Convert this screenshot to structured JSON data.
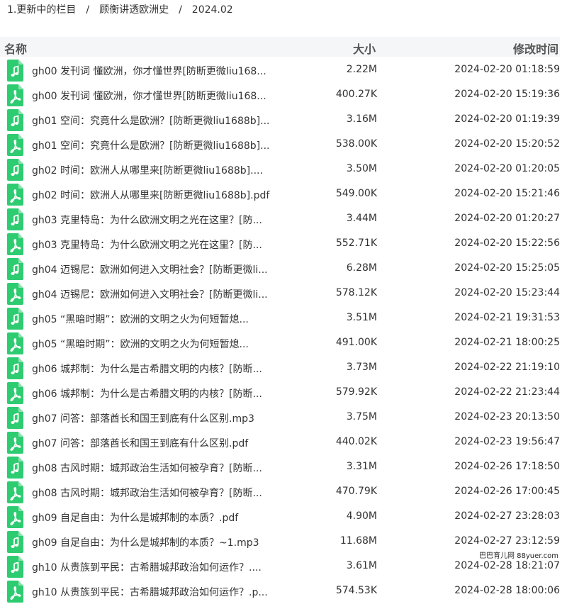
{
  "breadcrumb": {
    "items": [
      "1.更新中的栏目",
      "顾衡讲透欧洲史",
      "2024.02"
    ],
    "separator": "/"
  },
  "table": {
    "headers": {
      "name": "名称",
      "size": "大小",
      "time": "修改时间"
    },
    "rows": [
      {
        "name": "gh00 发刊词 懂欧洲，你才懂世界[防断更微liu168...",
        "size": "2.22M",
        "time": "2024-02-20 01:18:59",
        "icon": "mp3-file-icon"
      },
      {
        "name": "gh00 发刊词 懂欧洲，你才懂世界[防断更微liu168...",
        "size": "400.27K",
        "time": "2024-02-20 15:19:36",
        "icon": "pdf-file-icon"
      },
      {
        "name": "gh01 空间：究竟什么是欧洲？[防断更微liu1688b]...",
        "size": "3.16M",
        "time": "2024-02-20 01:19:39",
        "icon": "mp3-file-icon"
      },
      {
        "name": "gh01 空间：究竟什么是欧洲？[防断更微liu1688b]...",
        "size": "538.00K",
        "time": "2024-02-20 15:20:52",
        "icon": "pdf-file-icon"
      },
      {
        "name": "gh02 时间：欧洲人从哪里来[防断更微liu1688b]....",
        "size": "3.50M",
        "time": "2024-02-20 01:20:05",
        "icon": "mp3-file-icon"
      },
      {
        "name": "gh02 时间：欧洲人从哪里来[防断更微liu1688b].pdf",
        "size": "549.00K",
        "time": "2024-02-20 15:21:46",
        "icon": "pdf-file-icon"
      },
      {
        "name": "gh03 克里特岛：为什么欧洲文明之光在这里？[防...",
        "size": "3.44M",
        "time": "2024-02-20 01:20:27",
        "icon": "mp3-file-icon"
      },
      {
        "name": "gh03 克里特岛：为什么欧洲文明之光在这里？[防...",
        "size": "552.71K",
        "time": "2024-02-20 15:22:56",
        "icon": "pdf-file-icon"
      },
      {
        "name": "gh04 迈锡尼：欧洲如何进入文明社会？[防断更微li...",
        "size": "6.28M",
        "time": "2024-02-20 15:25:05",
        "icon": "mp3-file-icon"
      },
      {
        "name": "gh04 迈锡尼：欧洲如何进入文明社会？[防断更微li...",
        "size": "578.12K",
        "time": "2024-02-20 15:23:44",
        "icon": "pdf-file-icon"
      },
      {
        "name": "gh05 “黑暗时期”：欧洲的文明之火为何短暂熄...",
        "size": "3.51M",
        "time": "2024-02-21 19:31:53",
        "icon": "mp3-file-icon"
      },
      {
        "name": "gh05 “黑暗时期”：欧洲的文明之火为何短暂熄...",
        "size": "491.00K",
        "time": "2024-02-21 18:00:25",
        "icon": "pdf-file-icon"
      },
      {
        "name": "gh06 城邦制：为什么是古希腊文明的内核？[防断...",
        "size": "3.73M",
        "time": "2024-02-22 21:19:10",
        "icon": "mp3-file-icon"
      },
      {
        "name": "gh06 城邦制：为什么是古希腊文明的内核？[防断...",
        "size": "579.92K",
        "time": "2024-02-22 21:23:44",
        "icon": "pdf-file-icon"
      },
      {
        "name": "gh07 问答：部落酋长和国王到底有什么区别.mp3",
        "size": "3.75M",
        "time": "2024-02-23 20:13:50",
        "icon": "mp3-file-icon"
      },
      {
        "name": "gh07 问答：部落酋长和国王到底有什么区别.pdf",
        "size": "440.02K",
        "time": "2024-02-23 19:56:47",
        "icon": "pdf-file-icon"
      },
      {
        "name": "gh08 古风时期：城邦政治生活如何被孕育？[防断...",
        "size": "3.31M",
        "time": "2024-02-26 17:18:50",
        "icon": "mp3-file-icon"
      },
      {
        "name": "gh08 古风时期：城邦政治生活如何被孕育？[防断...",
        "size": "470.79K",
        "time": "2024-02-26 17:00:45",
        "icon": "pdf-file-icon"
      },
      {
        "name": "gh09 自足自由：为什么是城邦制的本质？.pdf",
        "size": "4.90M",
        "time": "2024-02-27 23:28:03",
        "icon": "pdf-file-icon"
      },
      {
        "name": "gh09 自足自由：为什么是城邦制的本质？~1.mp3",
        "size": "11.68M",
        "time": "2024-02-27 23:12:59",
        "icon": "mp3-file-icon"
      },
      {
        "name": "gh10 从贵族到平民：古希腊城邦政治如何运作？....",
        "size": "3.61M",
        "time": "2024-02-28 18:21:07",
        "icon": "mp3-file-icon"
      },
      {
        "name": "gh10 从贵族到平民：古希腊城邦政治如何运作？.p...",
        "size": "574.53K",
        "time": "2024-02-28 18:00:06",
        "icon": "pdf-file-icon"
      }
    ]
  },
  "watermark": "巴巴育儿网 88yuer.com",
  "colors": {
    "mp3_icon": "#2ecc71",
    "pdf_icon": "#2ecc71",
    "header_bg": "#f5f6f7"
  }
}
